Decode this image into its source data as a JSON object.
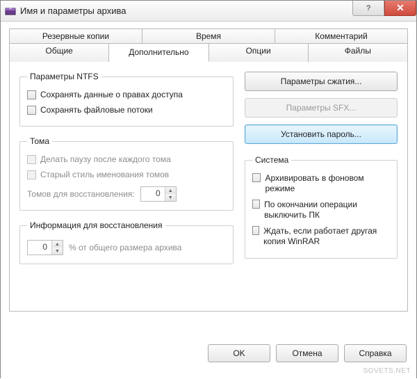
{
  "window": {
    "title": "Имя и параметры архива"
  },
  "tabs": {
    "row1": [
      "Резервные копии",
      "Время",
      "Комментарий"
    ],
    "row2": [
      "Общие",
      "Дополнительно",
      "Опции",
      "Файлы"
    ]
  },
  "ntfs": {
    "legend": "Параметры NTFS",
    "save_security": "Сохранять данные о правах доступа",
    "save_streams": "Сохранять файловые потоки"
  },
  "volumes": {
    "legend": "Тома",
    "pause_each": "Делать паузу после каждого тома",
    "old_style": "Старый стиль именования томов",
    "recovery_label": "Томов для восстановления:",
    "recovery_value": "0"
  },
  "recovery": {
    "legend": "Информация для восстановления",
    "value": "0",
    "suffix": "% от общего размера архива"
  },
  "right": {
    "compression": "Параметры сжатия...",
    "sfx": "Параметры SFX...",
    "password": "Установить пароль..."
  },
  "system": {
    "legend": "Система",
    "background": "Архивировать в фоновом режиме",
    "shutdown": "По окончании операции выключить ПК",
    "wait": "Ждать, если работает другая копия WinRAR"
  },
  "footer": {
    "ok": "OK",
    "cancel": "Отмена",
    "help": "Справка"
  },
  "watermark": "SOVETS.NET"
}
